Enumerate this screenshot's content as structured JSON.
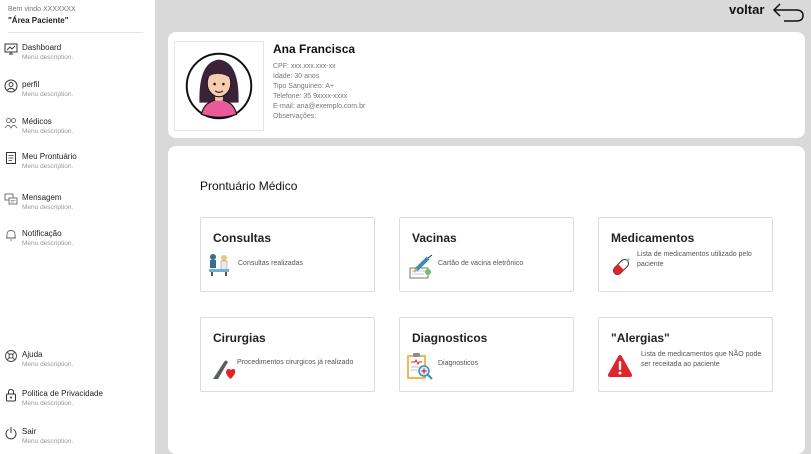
{
  "sidebar": {
    "welcome": "Bem vindo XXXXXXX",
    "area": "\"Área Paciente\"",
    "items": [
      {
        "label": "Dashboard",
        "desc": "Menu description.",
        "icon": "monitor-icon"
      },
      {
        "label": "perfil",
        "desc": "Menu description.",
        "icon": "user-icon"
      },
      {
        "label": "Médicos",
        "desc": "Menu description.",
        "icon": "doctors-icon"
      },
      {
        "label": "Meu Prontuário",
        "desc": "Menu description.",
        "icon": "record-icon"
      },
      {
        "label": "Mensagem",
        "desc": "Menu description.",
        "icon": "message-icon"
      },
      {
        "label": "Notificação",
        "desc": "Menu description.",
        "icon": "bell-icon"
      }
    ],
    "bottom_items": [
      {
        "label": "Ajuda",
        "desc": "Menu description.",
        "icon": "help-icon"
      },
      {
        "label": "Politica de Privacidade",
        "desc": "Menu description.",
        "icon": "lock-icon"
      },
      {
        "label": "Sair",
        "desc": "Menu description.",
        "icon": "power-icon"
      }
    ]
  },
  "header": {
    "back_label": "voltar"
  },
  "profile": {
    "name": "Ana Francisca",
    "cpf": "CPF: xxx.xxx.xxx-xx",
    "idade": "Idade: 30 anos",
    "tipo": "Tipo Sanguineo: A+",
    "telefone": "Telefone: 35 9xxxx-xxxx",
    "email": "E-mail: ana@exemplo.com.br",
    "obs": "Observações:"
  },
  "record": {
    "title": "Prontuário Médico",
    "tiles": [
      {
        "title": "Consultas",
        "desc": "Consultas  realizadas",
        "icon": "consultation-icon"
      },
      {
        "title": "Vacinas",
        "desc": "Cartão de vacina eletrônico",
        "icon": "vaccine-icon"
      },
      {
        "title": "Medicamentos",
        "desc": "Lista de medicamentos utilizado pelo paciente",
        "icon": "pill-icon"
      },
      {
        "title": "Cirurgias",
        "desc": "Procedimentos cirurgicos já realizado",
        "icon": "surgery-icon"
      },
      {
        "title": "Diagnosticos",
        "desc": "Diagnosticos",
        "icon": "diagnosis-icon"
      },
      {
        "title": "\"Alergias\"",
        "desc": "Lista de medicamentos que NÃO pode ser receitada ao paciente",
        "icon": "warning-icon"
      }
    ]
  },
  "colors": {
    "background": "#d9d9d9",
    "card": "#ffffff",
    "warning": "#e0242c"
  }
}
